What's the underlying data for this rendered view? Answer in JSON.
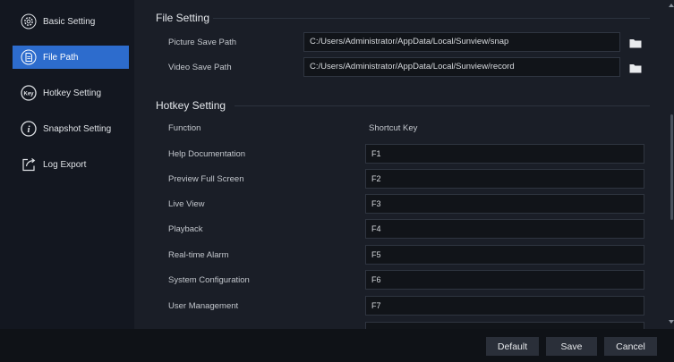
{
  "sidebar": {
    "items": [
      {
        "label": "Basic Setting",
        "icon": "gear-icon"
      },
      {
        "label": "File Path",
        "icon": "file-icon",
        "active": true
      },
      {
        "label": "Hotkey Setting",
        "icon": "key-icon"
      },
      {
        "label": "Snapshot Setting",
        "icon": "info-icon"
      },
      {
        "label": "Log Export",
        "icon": "export-icon"
      }
    ],
    "key_icon_text": "Key",
    "info_icon_text": "i"
  },
  "file_setting": {
    "title": "File Setting",
    "picture_label": "Picture Save Path",
    "picture_value": "C:/Users/Administrator/AppData/Local/Sunview/snap",
    "video_label": "Video Save Path",
    "video_value": "C:/Users/Administrator/AppData/Local/Sunview/record"
  },
  "hotkey_setting": {
    "title": "Hotkey Setting",
    "col_function": "Function",
    "col_shortcut": "Shortcut Key",
    "rows": [
      {
        "function": "Help Documentation",
        "key": "F1"
      },
      {
        "function": "Preview Full Screen",
        "key": "F2"
      },
      {
        "function": "Live View",
        "key": "F3"
      },
      {
        "function": "Playback",
        "key": "F4"
      },
      {
        "function": "Real-time Alarm",
        "key": "F5"
      },
      {
        "function": "System Configuration",
        "key": "F6"
      },
      {
        "function": "User Management",
        "key": "F7"
      }
    ]
  },
  "footer": {
    "default_label": "Default",
    "save_label": "Save",
    "cancel_label": "Cancel"
  },
  "colors": {
    "accent": "#2d6ccd",
    "background": "#1a1e27",
    "sidebar": "#131720"
  }
}
